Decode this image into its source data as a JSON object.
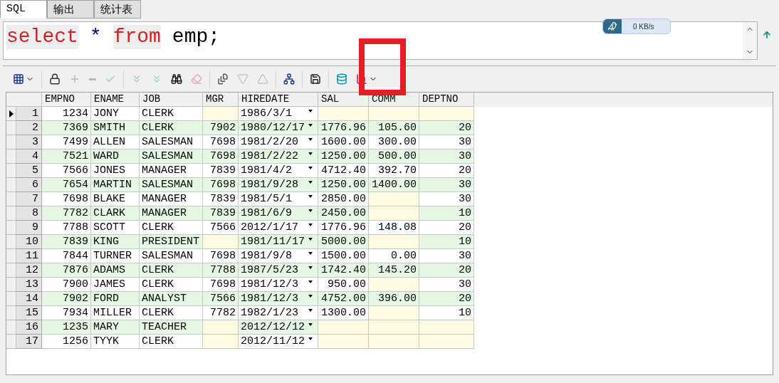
{
  "tabs": [
    {
      "label": "SQL",
      "selected": true
    },
    {
      "label": "输出",
      "selected": false
    },
    {
      "label": "统计表",
      "selected": false
    }
  ],
  "editor": {
    "tokens": [
      {
        "text": "select",
        "kind": "keyword"
      },
      {
        "text": "*",
        "kind": "operator"
      },
      {
        "text": "from",
        "kind": "keyword"
      },
      {
        "text": "emp;",
        "kind": "identifier"
      }
    ]
  },
  "speed_widget": {
    "reading": "0 KB/s"
  },
  "toolbar": [
    {
      "kind": "grid",
      "disabled": false
    },
    {
      "kind": "lock",
      "disabled": false
    },
    {
      "kind": "add",
      "disabled": true
    },
    {
      "kind": "remove",
      "disabled": true
    },
    {
      "kind": "post",
      "disabled": true
    },
    {
      "kind": "next",
      "disabled": true
    },
    {
      "kind": "last",
      "disabled": true
    },
    {
      "kind": "find",
      "disabled": false
    },
    {
      "kind": "clear",
      "disabled": true
    },
    {
      "kind": "export",
      "disabled": false
    },
    {
      "kind": "down",
      "disabled": true
    },
    {
      "kind": "up",
      "disabled": true
    },
    {
      "kind": "tree",
      "disabled": false
    },
    {
      "kind": "save",
      "disabled": false
    },
    {
      "kind": "database",
      "disabled": false
    },
    {
      "kind": "chart",
      "disabled": false
    }
  ],
  "table": {
    "columns": [
      "EMPNO",
      "ENAME",
      "JOB",
      "MGR",
      "HIREDATE",
      "SAL",
      "COMM",
      "DEPTNO"
    ],
    "rows": [
      {
        "number": "1",
        "selected": true,
        "cells": [
          "1234",
          "JONY",
          "CLERK",
          null,
          "1986/3/1",
          null,
          null,
          null
        ]
      },
      {
        "number": "2",
        "selected": false,
        "cells": [
          "7369",
          "SMITH",
          "CLERK",
          "7902",
          "1980/12/17",
          "1776.96",
          "105.60",
          "20"
        ]
      },
      {
        "number": "3",
        "selected": false,
        "cells": [
          "7499",
          "ALLEN",
          "SALESMAN",
          "7698",
          "1981/2/20",
          "1600.00",
          "300.00",
          "30"
        ]
      },
      {
        "number": "4",
        "selected": false,
        "cells": [
          "7521",
          "WARD",
          "SALESMAN",
          "7698",
          "1981/2/22",
          "1250.00",
          "500.00",
          "30"
        ]
      },
      {
        "number": "5",
        "selected": false,
        "cells": [
          "7566",
          "JONES",
          "MANAGER",
          "7839",
          "1981/4/2",
          "4712.40",
          "392.70",
          "20"
        ]
      },
      {
        "number": "6",
        "selected": false,
        "cells": [
          "7654",
          "MARTIN",
          "SALESMAN",
          "7698",
          "1981/9/28",
          "1250.00",
          "1400.00",
          "30"
        ]
      },
      {
        "number": "7",
        "selected": false,
        "cells": [
          "7698",
          "BLAKE",
          "MANAGER",
          "7839",
          "1981/5/1",
          "2850.00",
          null,
          "30"
        ]
      },
      {
        "number": "8",
        "selected": false,
        "cells": [
          "7782",
          "CLARK",
          "MANAGER",
          "7839",
          "1981/6/9",
          "2450.00",
          null,
          "10"
        ]
      },
      {
        "number": "9",
        "selected": false,
        "cells": [
          "7788",
          "SCOTT",
          "CLERK",
          "7566",
          "2012/1/17",
          "1776.96",
          "148.08",
          "20"
        ]
      },
      {
        "number": "10",
        "selected": false,
        "cells": [
          "7839",
          "KING",
          "PRESIDENT",
          null,
          "1981/11/17",
          "5000.00",
          null,
          "10"
        ]
      },
      {
        "number": "11",
        "selected": false,
        "cells": [
          "7844",
          "TURNER",
          "SALESMAN",
          "7698",
          "1981/9/8",
          "1500.00",
          "0.00",
          "30"
        ]
      },
      {
        "number": "12",
        "selected": false,
        "cells": [
          "7876",
          "ADAMS",
          "CLERK",
          "7788",
          "1987/5/23",
          "1742.40",
          "145.20",
          "20"
        ]
      },
      {
        "number": "13",
        "selected": false,
        "cells": [
          "7900",
          "JAMES",
          "CLERK",
          "7698",
          "1981/12/3",
          "950.00",
          null,
          "30"
        ]
      },
      {
        "number": "14",
        "selected": false,
        "cells": [
          "7902",
          "FORD",
          "ANALYST",
          "7566",
          "1981/12/3",
          "4752.00",
          "396.00",
          "20"
        ]
      },
      {
        "number": "15",
        "selected": false,
        "cells": [
          "7934",
          "MILLER",
          "CLERK",
          "7782",
          "1982/1/23",
          "1300.00",
          null,
          "10"
        ]
      },
      {
        "number": "16",
        "selected": false,
        "cells": [
          "1235",
          "MARY",
          "TEACHER",
          null,
          "2012/12/12",
          null,
          null,
          null
        ]
      },
      {
        "number": "17",
        "selected": false,
        "cells": [
          "1256",
          "TYYK",
          "CLERK",
          null,
          "2012/11/12",
          null,
          null,
          null
        ]
      }
    ]
  }
}
